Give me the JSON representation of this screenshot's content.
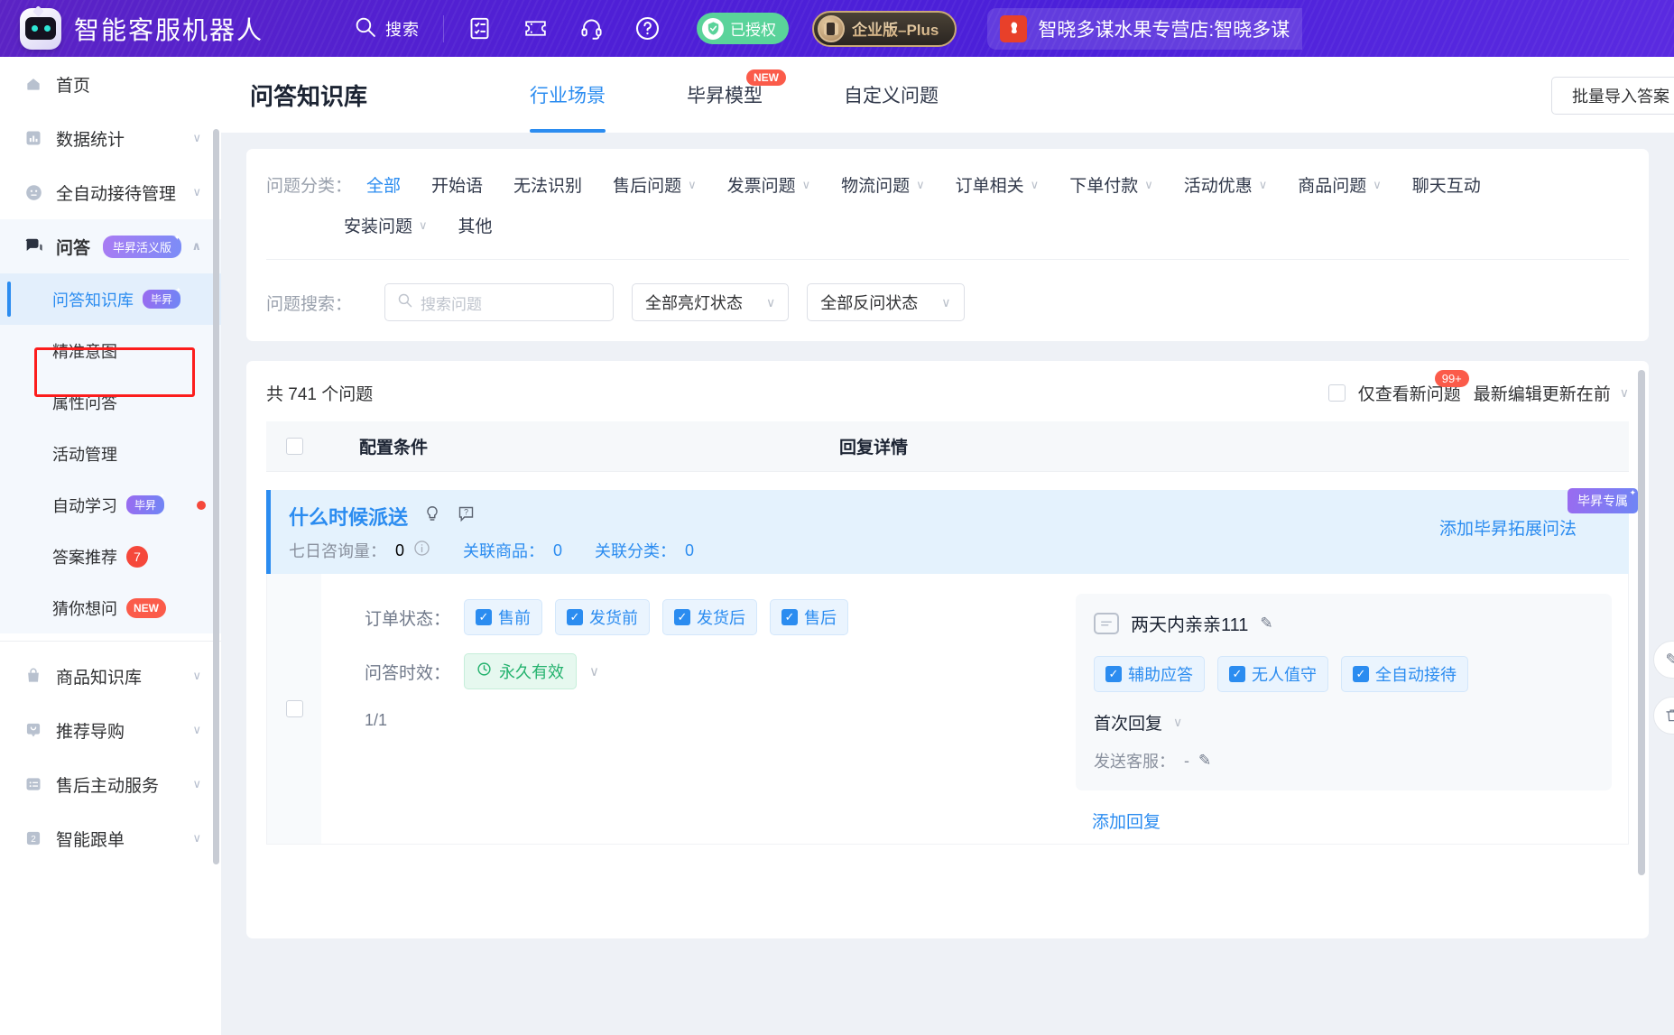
{
  "header": {
    "brand": "智能客服机器人",
    "search_label": "搜索",
    "icons": [
      "search-icon",
      "form-icon",
      "ticket-icon",
      "headset-icon",
      "help-icon"
    ],
    "auth_badge": "已授权",
    "plus_badge": "企业版–Plus",
    "shop_name": "智晓多谋水果专营店:智晓多谋",
    "shop_logo_text": "京东"
  },
  "sidebar": {
    "items": [
      {
        "label": "首页",
        "icon": "home-icon",
        "arrow": false
      },
      {
        "label": "数据统计",
        "icon": "chart-icon",
        "arrow": true
      },
      {
        "label": "全自动接待管理",
        "icon": "face-icon",
        "arrow": true
      },
      {
        "label": "问答",
        "icon": "chat-icon",
        "arrow": true,
        "tag": "毕昇活义版",
        "expanded": true
      }
    ],
    "sub_items": [
      {
        "label": "问答知识库",
        "tag": "毕昇",
        "active": true
      },
      {
        "label": "精准意图"
      },
      {
        "label": "属性问答"
      },
      {
        "label": "活动管理"
      },
      {
        "label": "自动学习",
        "tag": "毕昇",
        "dot": true
      },
      {
        "label": "答案推荐",
        "count": "7"
      },
      {
        "label": "猜你想问",
        "new": "NEW"
      }
    ],
    "bottom_items": [
      {
        "label": "商品知识库",
        "icon": "bag-icon",
        "arrow": true
      },
      {
        "label": "推荐导购",
        "icon": "recommend-icon",
        "arrow": true
      },
      {
        "label": "售后主动服务",
        "icon": "list-icon",
        "arrow": true
      },
      {
        "label": "智能跟单",
        "icon": "order-icon",
        "arrow": true
      }
    ]
  },
  "page": {
    "title": "问答知识库",
    "tabs": [
      {
        "label": "行业场景",
        "active": true
      },
      {
        "label": "毕昇模型",
        "active": false,
        "new": "NEW"
      },
      {
        "label": "自定义问题",
        "active": false
      }
    ],
    "import_button": "批量导入答案"
  },
  "filters": {
    "category_label": "问题分类：",
    "categories": [
      {
        "label": "全部",
        "active": true,
        "caret": false
      },
      {
        "label": "开始语",
        "caret": false
      },
      {
        "label": "无法识别",
        "caret": false
      },
      {
        "label": "售后问题",
        "caret": true
      },
      {
        "label": "发票问题",
        "caret": true
      },
      {
        "label": "物流问题",
        "caret": true
      },
      {
        "label": "订单相关",
        "caret": true
      },
      {
        "label": "下单付款",
        "caret": true
      },
      {
        "label": "活动优惠",
        "caret": true
      },
      {
        "label": "商品问题",
        "caret": true
      },
      {
        "label": "聊天互动",
        "caret": true
      }
    ],
    "categories_row2": [
      {
        "label": "安装问题",
        "caret": true
      },
      {
        "label": "其他",
        "caret": false
      }
    ],
    "search_label": "问题搜索：",
    "search_placeholder": "搜索问题",
    "light_status": "全部亮灯状态",
    "reverse_status": "全部反问状态"
  },
  "list": {
    "count_text": "共 741 个问题",
    "only_new_label": "仅查看新问题",
    "only_new_badge": "99+",
    "sort_label": "最新编辑更新在前",
    "columns": [
      "配置条件",
      "回复详情"
    ],
    "question": {
      "title": "什么时候派送",
      "meta_label": "七日咨询量：",
      "meta_value": "0",
      "related_goods_label": "关联商品：",
      "related_goods_value": "0",
      "related_cat_label": "关联分类：",
      "related_cat_value": "0",
      "add_expand": "添加毕昇拓展问法",
      "corner_tag": "毕昇专属"
    },
    "config": {
      "order_status_label": "订单状态：",
      "order_status_options": [
        "售前",
        "发货前",
        "发货后",
        "售后"
      ],
      "validity_label": "问答时效：",
      "validity_value": "永久有效",
      "page_indicator": "1/1"
    },
    "reply": {
      "text": "两天内亲亲111",
      "chips": [
        "辅助应答",
        "无人值守",
        "全自动接待"
      ],
      "first_reply_label": "首次回复",
      "send_cs_label": "发送客服：",
      "send_cs_value": "-",
      "add_reply": "添加回复"
    }
  }
}
